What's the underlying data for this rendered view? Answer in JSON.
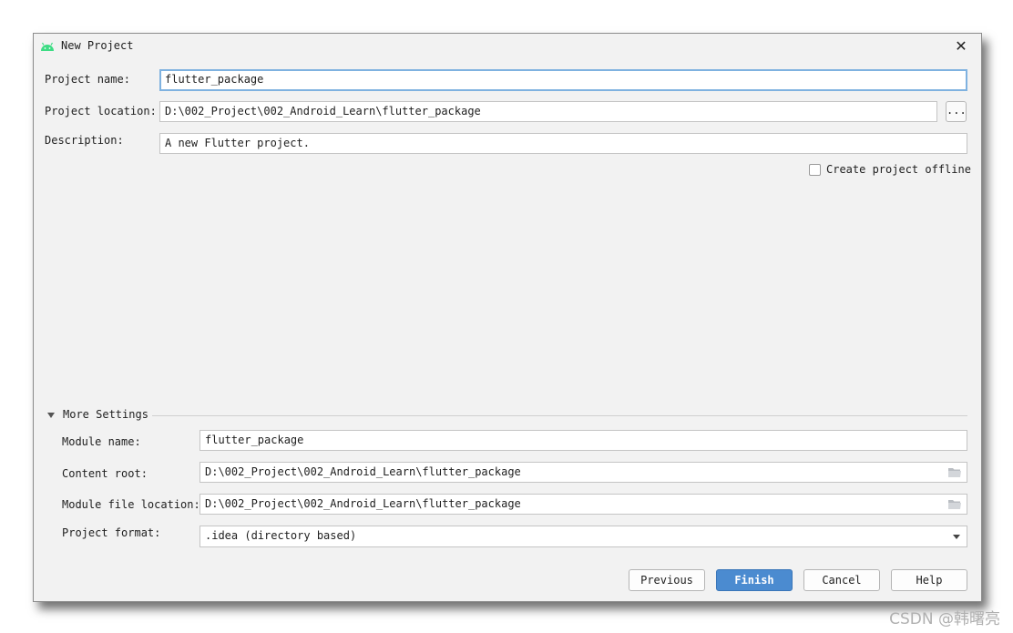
{
  "window": {
    "title": "New Project",
    "icon": "android-icon",
    "close_icon": "close-icon"
  },
  "form": {
    "project_name": {
      "label": "Project name:",
      "value": "flutter_package"
    },
    "project_location": {
      "label": "Project location:",
      "value": "D:\\002_Project\\002_Android_Learn\\flutter_package",
      "browse_label": "..."
    },
    "description": {
      "label": "Description:",
      "value": "A new Flutter project."
    },
    "offline": {
      "label": "Create project offline",
      "checked": false
    }
  },
  "more_settings": {
    "title": "More Settings",
    "expanded": true,
    "module_name": {
      "label": "Module name:",
      "value": "flutter_package"
    },
    "content_root": {
      "label": "Content root:",
      "value": "D:\\002_Project\\002_Android_Learn\\flutter_package"
    },
    "module_file_location": {
      "label": "Module file location:",
      "value": "D:\\002_Project\\002_Android_Learn\\flutter_package"
    },
    "project_format": {
      "label": "Project format:",
      "value": ".idea (directory based)"
    }
  },
  "buttons": {
    "previous": "Previous",
    "finish": "Finish",
    "cancel": "Cancel",
    "help": "Help"
  },
  "watermark": "CSDN @韩曙亮",
  "colors": {
    "primary_button": "#4b8bd0",
    "focus_border": "#7fb2e0",
    "android_green": "#3ddc84"
  }
}
